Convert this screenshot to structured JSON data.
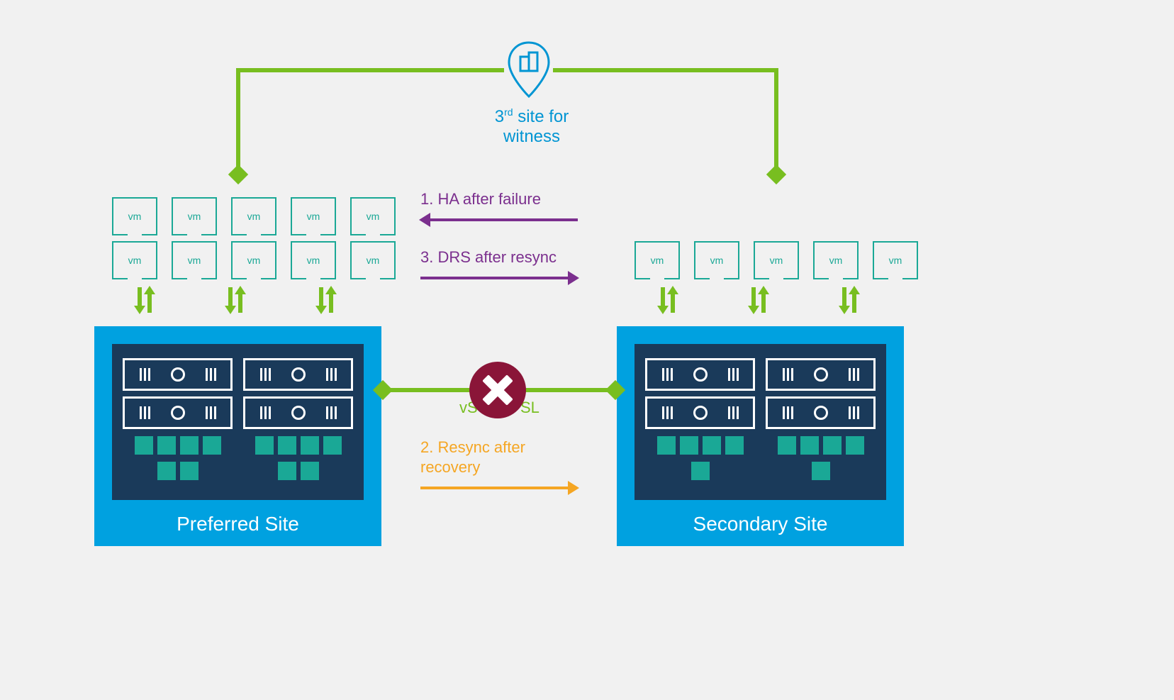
{
  "witness": {
    "label_line1": "3",
    "label_sup": "rd",
    "label_rest": " site for",
    "label_line2": "witness"
  },
  "vm_label": "vm",
  "steps": {
    "s1": "1. HA after failure",
    "s2_line1": "2. Resync after",
    "s2_line2": "recovery",
    "s3": "3. DRS after resync"
  },
  "isl": {
    "left_fragment": "vS",
    "right_fragment": "SL"
  },
  "sites": {
    "preferred": "Preferred Site",
    "secondary": "Secondary Site"
  }
}
